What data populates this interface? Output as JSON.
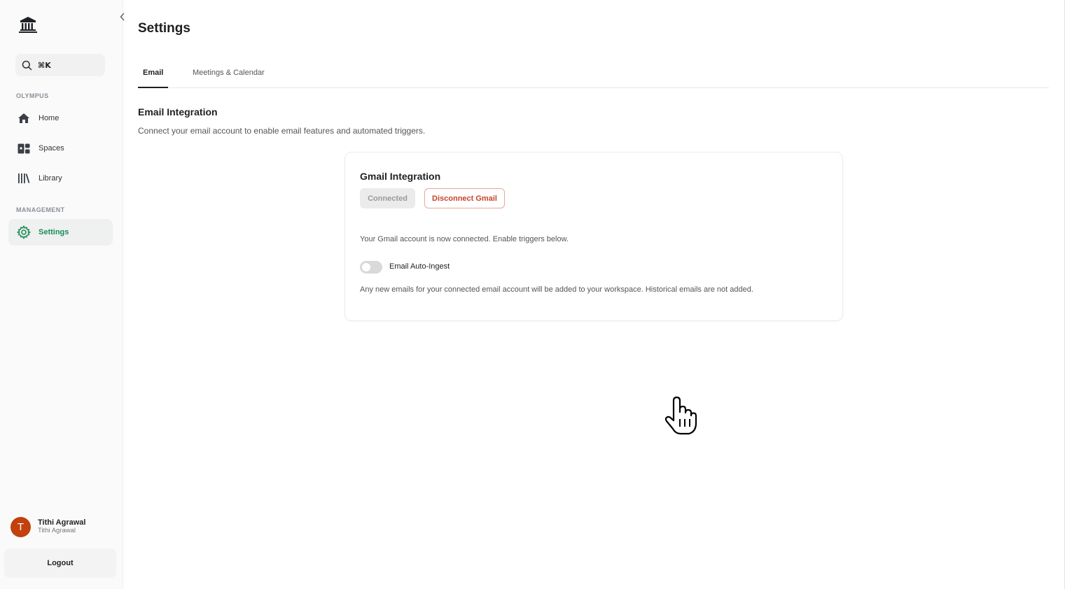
{
  "sidebar": {
    "collapse_icon": "chevron-left-icon",
    "search": {
      "shortcut": "⌘K"
    },
    "sections": [
      {
        "label": "OLYMPUS"
      },
      {
        "label": "MANAGEMENT"
      }
    ],
    "items": [
      {
        "label": "Home",
        "icon": "home-icon"
      },
      {
        "label": "Spaces",
        "icon": "spaces-icon"
      },
      {
        "label": "Library",
        "icon": "library-icon"
      },
      {
        "label": "Settings",
        "icon": "gear-icon",
        "active": true
      }
    ],
    "user": {
      "initial": "T",
      "name": "Tithi Agrawal",
      "subtitle": "Tithi Agrawal"
    },
    "logout_label": "Logout"
  },
  "main": {
    "title": "Settings",
    "tabs": [
      {
        "label": "Email",
        "active": true
      },
      {
        "label": "Meetings & Calendar"
      }
    ],
    "section_title": "Email Integration",
    "section_desc": "Connect your email account to enable email features and automated triggers.",
    "card": {
      "title": "Gmail Integration",
      "connected_label": "Connected",
      "disconnect_label": "Disconnect Gmail",
      "status_text": "Your Gmail account is now connected. Enable triggers below.",
      "toggle_label": "Email Auto-Ingest",
      "toggle_on": false,
      "help_text": "Any new emails for your connected email account will be added to your workspace. Historical emails are not added."
    }
  },
  "colors": {
    "accent": "#1c8a5a",
    "danger": "#c9432a",
    "avatar": "#c2410c"
  }
}
